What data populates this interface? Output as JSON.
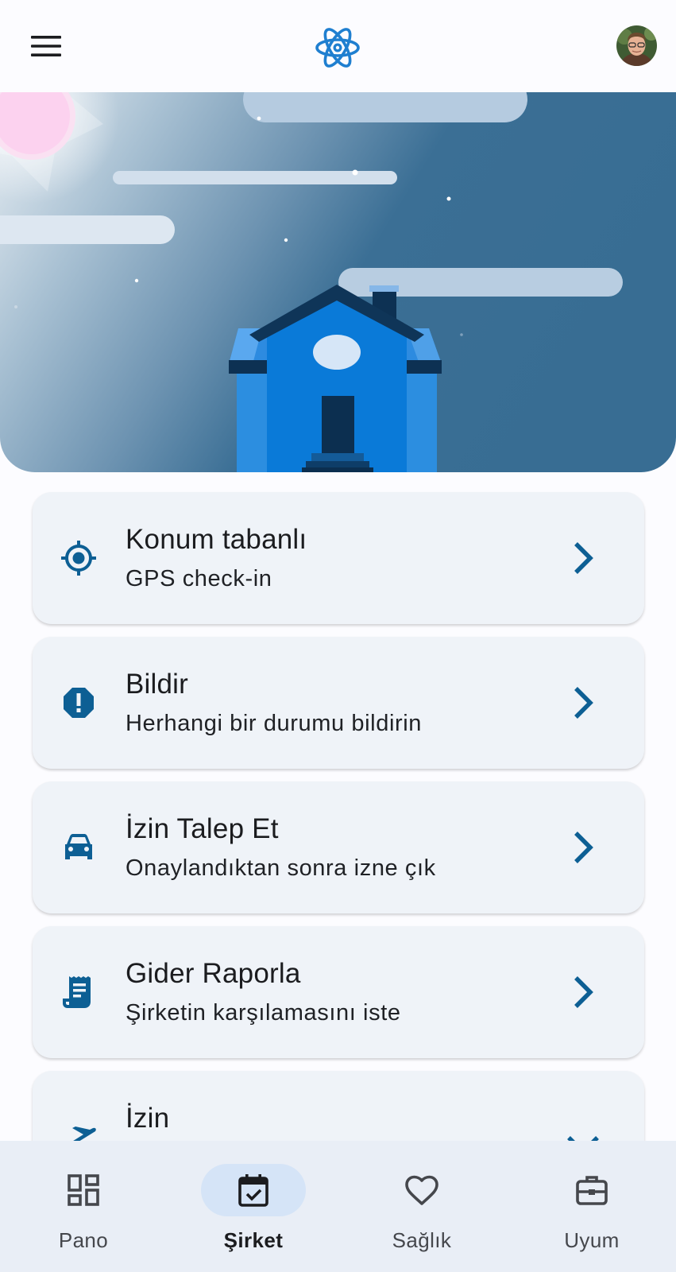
{
  "app": {
    "logo_icon": "atom-icon",
    "menu_icon": "hamburger-menu-icon",
    "avatar_icon": "user-avatar",
    "accent_color": "#1f7fd0",
    "icon_color": "#0d5f94"
  },
  "cards": [
    {
      "title": "Konum tabanlı",
      "subtitle": "GPS check-in",
      "icon": "gps-target-icon",
      "trailing": "chevron-right-icon"
    },
    {
      "title": "Bildir",
      "subtitle": "Herhangi bir durumu bildirin",
      "icon": "report-alert-icon",
      "trailing": "chevron-right-icon"
    },
    {
      "title": "İzin Talep Et",
      "subtitle": "Onaylandıktan sonra izne çık",
      "icon": "car-icon",
      "trailing": "chevron-right-icon"
    },
    {
      "title": "Gider Raporla",
      "subtitle": "Şirketin karşılamasını iste",
      "icon": "receipt-icon",
      "trailing": "chevron-right-icon"
    },
    {
      "title": "İzin",
      "subtitle": "",
      "icon": "flight-takeoff-icon",
      "trailing": "chevron-down-icon"
    }
  ],
  "bottom_nav": {
    "selected": "Şirket",
    "items": [
      {
        "label": "Pano",
        "icon": "dashboard-icon"
      },
      {
        "label": "Şirket",
        "icon": "calendar-check-icon"
      },
      {
        "label": "Sağlık",
        "icon": "heart-icon"
      },
      {
        "label": "Uyum",
        "icon": "briefcase-icon"
      }
    ]
  }
}
